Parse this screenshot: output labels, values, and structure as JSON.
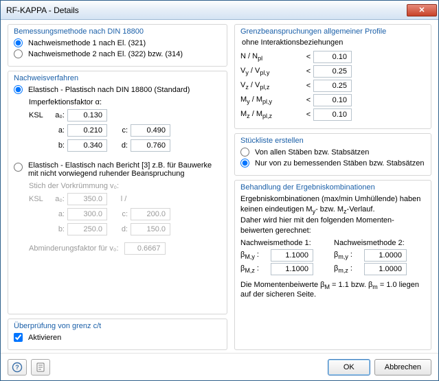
{
  "window": {
    "title": "RF-KAPPA - Details"
  },
  "method": {
    "legend": "Bemessungsmethode nach DIN 18800",
    "opt1": "Nachweismethode 1 nach El. (321)",
    "opt2": "Nachweismethode 2 nach El. (322) bzw. (314)",
    "selected": 1
  },
  "proc": {
    "legend": "Nachweisverfahren",
    "opt_ep": "Elastisch - Plastisch nach DIN 18800 (Standard)",
    "imp_label": "Imperfektionsfaktor α:",
    "ksl": "KSL",
    "row_a0": {
      "l": "a₀:",
      "v": "0.130"
    },
    "row_a": {
      "l": "a:",
      "v": "0.210",
      "l2": "c:",
      "v2": "0.490"
    },
    "row_b": {
      "l": "b:",
      "v": "0.340",
      "l2": "d:",
      "v2": "0.760"
    },
    "opt_ee": "Elastisch - Elastisch nach Bericht [3] z.B. für Bauwerke mit nicht vorwiegend ruhender Beanspruchung",
    "stich_label": "Stich der Vorkrümmung v₀:",
    "row2_a0": {
      "l": "a₀:",
      "v": "350.0",
      "l2": "l /"
    },
    "row2_a": {
      "l": "a:",
      "v": "300.0",
      "l2": "c:",
      "v2": "200.0"
    },
    "row2_b": {
      "l": "b:",
      "v": "250.0",
      "l2": "d:",
      "v2": "150.0"
    },
    "abm_label": "Abminderungsfaktor für v₀:",
    "abm_val": "0.6667"
  },
  "ct": {
    "legend": "Überprüfung von grenz c/t",
    "chk": "Aktivieren",
    "checked": true
  },
  "limits": {
    "legend": "Grenzbeanspruchungen allgemeiner Profile",
    "sub": "ohne Interaktionsbeziehungen",
    "rows": [
      {
        "name": "N / Nₚₗ",
        "v": "0.10"
      },
      {
        "name": "Vᵧ / Vₚₗ,ᵧ",
        "v": "0.25"
      },
      {
        "name": "V_z / Vₚₗ,_z",
        "v": "0.25"
      },
      {
        "name": "Mᵧ / Mₚₗ,ᵧ",
        "v": "0.10"
      },
      {
        "name": "M_z / Mₚₗ,_z",
        "v": "0.10"
      }
    ]
  },
  "stl": {
    "legend": "Stückliste erstellen",
    "opt1": "Von allen Stäben bzw. Stabsätzen",
    "opt2": "Nur von zu bemessenden Stäben bzw. Stabsätzen",
    "selected": 2
  },
  "rc": {
    "legend": "Behandlung der Ergebniskombinationen",
    "text": "Ergebniskombinationen (max/min Umhüllende) haben keinen eindeutigen Mᵧ- bzw. M_z-Verlauf. Daher wird hier mit den folgenden Momentenbeiwerten gerechnet:",
    "h1": "Nachweismethode 1:",
    "h2": "Nachweismethode 2:",
    "bmy": "βM,y :",
    "bmz": "βM,z :",
    "bmy2": "βm,y :",
    "bmz2": "βm,z :",
    "v1y": "1.1000",
    "v1z": "1.1000",
    "v2y": "1.0000",
    "v2z": "1.0000",
    "note": "Die Momentenbeiwerte βM = 1.1 bzw. βm = 1.0 liegen auf der sicheren Seite."
  },
  "buttons": {
    "ok": "OK",
    "cancel": "Abbrechen"
  }
}
